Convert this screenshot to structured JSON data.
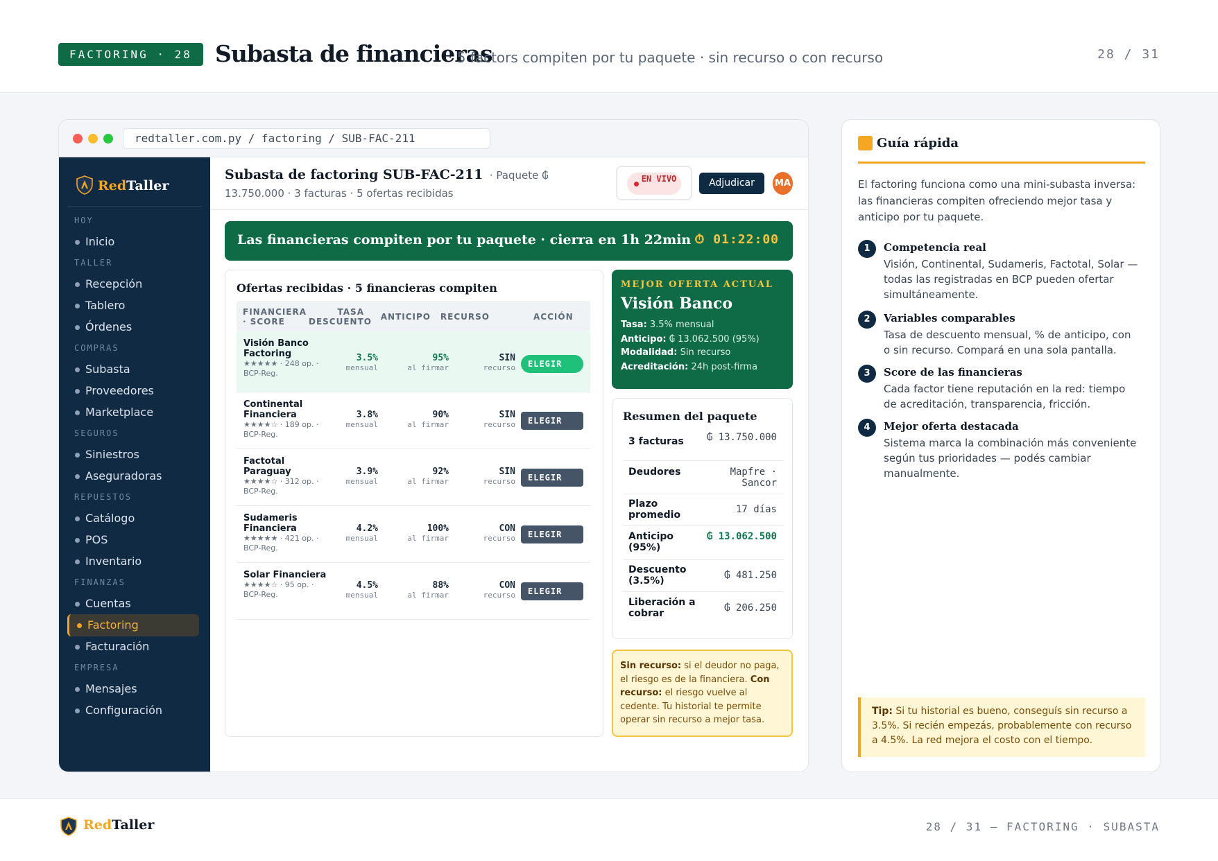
{
  "header": {
    "badge": "FACTORING · 28",
    "title": "Subasta de financieras",
    "subtitle": "· 5 factors compiten por tu paquete · sin recurso o con recurso",
    "page": "28 / 31"
  },
  "browser": {
    "url": "redtaller.com.py / factoring / SUB-FAC-211"
  },
  "brand": {
    "red": "Red",
    "taller": "Taller"
  },
  "sidebar": {
    "sections": [
      {
        "label": "HOY",
        "items": [
          "Inicio"
        ]
      },
      {
        "label": "TALLER",
        "items": [
          "Recepción",
          "Tablero",
          "Órdenes"
        ]
      },
      {
        "label": "COMPRAS",
        "items": [
          "Subasta",
          "Proveedores",
          "Marketplace"
        ]
      },
      {
        "label": "SEGUROS",
        "items": [
          "Siniestros",
          "Aseguradoras"
        ]
      },
      {
        "label": "REPUESTOS",
        "items": [
          "Catálogo",
          "POS",
          "Inventario"
        ]
      },
      {
        "label": "FINANZAS",
        "items": [
          "Cuentas",
          "Factoring",
          "Facturación"
        ]
      },
      {
        "label": "EMPRESA",
        "items": [
          "Mensajes",
          "Configuración"
        ]
      }
    ],
    "active": "Factoring"
  },
  "main": {
    "title": "Subasta de factoring SUB-FAC-211",
    "meta": "· Paquete ₲ 13.750.000 · 3 facturas · 5 ofertas recibidas",
    "live": "EN VIVO",
    "adjudicar": "Adjudicar",
    "avatar": "MA",
    "banner": "Las financieras compiten por tu paquete · cierra en 1h 22min",
    "timer": "⏱ 01:22:00"
  },
  "offers": {
    "title": "Ofertas recibidas · 5 financieras compiten",
    "columns": {
      "fin": "FINANCIERA · SCORE",
      "tasa": "TASA DESCUENTO",
      "anticipo": "ANTICIPO",
      "recurso": "RECURSO",
      "accion": "ACCIÓN"
    },
    "rows": [
      {
        "name": "Visión Banco Factoring",
        "score": "★★★★★ · 248 op. · BCP-Reg.",
        "tasa": "3.5%",
        "tasa_sub": "mensual",
        "anticipo": "95%",
        "anticipo_sub": "al firmar",
        "recurso": "SIN",
        "recurso_sub": "recurso",
        "action": "ELEGIR"
      },
      {
        "name": "Continental Financiera",
        "score": "★★★★☆ · 189 op. · BCP-Reg.",
        "tasa": "3.8%",
        "tasa_sub": "mensual",
        "anticipo": "90%",
        "anticipo_sub": "al firmar",
        "recurso": "SIN",
        "recurso_sub": "recurso",
        "action": "ELEGIR"
      },
      {
        "name": "Factotal Paraguay",
        "score": "★★★★☆ · 312 op. · BCP-Reg.",
        "tasa": "3.9%",
        "tasa_sub": "mensual",
        "anticipo": "92%",
        "anticipo_sub": "al firmar",
        "recurso": "SIN",
        "recurso_sub": "recurso",
        "action": "ELEGIR"
      },
      {
        "name": "Sudameris Financiera",
        "score": "★★★★★ · 421 op. · BCP-Reg.",
        "tasa": "4.2%",
        "tasa_sub": "mensual",
        "anticipo": "100%",
        "anticipo_sub": "al firmar",
        "recurso": "CON",
        "recurso_sub": "recurso",
        "action": "ELEGIR"
      },
      {
        "name": "Solar Financiera",
        "score": "★★★★☆ · 95 op. · BCP-Reg.",
        "tasa": "4.5%",
        "tasa_sub": "mensual",
        "anticipo": "88%",
        "anticipo_sub": "al firmar",
        "recurso": "CON",
        "recurso_sub": "recurso",
        "action": "ELEGIR"
      }
    ]
  },
  "best": {
    "label": "MEJOR OFERTA ACTUAL",
    "name": "Visión Banco",
    "lines": [
      {
        "k": "Tasa:",
        "v": "3.5% mensual"
      },
      {
        "k": "Anticipo:",
        "v": "₲ 13.062.500 (95%)"
      },
      {
        "k": "Modalidad:",
        "v": "Sin recurso"
      },
      {
        "k": "Acreditación:",
        "v": "24h post-firma"
      }
    ]
  },
  "summary": {
    "title": "Resumen del paquete",
    "rows": [
      {
        "k": "3 facturas",
        "v": "₲ 13.750.000"
      },
      {
        "k": "Deudores",
        "v": "Mapfre · Sancor"
      },
      {
        "k": "Plazo promedio",
        "v": "17 días"
      },
      {
        "k": "Anticipo (95%)",
        "v": "₲ 13.062.500"
      },
      {
        "k": "Descuento (3.5%)",
        "v": "₲ 481.250"
      },
      {
        "k": "Liberación a cobrar",
        "v": "₲ 206.250"
      }
    ]
  },
  "note": {
    "sin_k": "Sin recurso:",
    "sin_v": "si el deudor no paga, el riesgo es de la financiera.",
    "con_k": "Con recurso:",
    "con_v": "el riesgo vuelve al cedente. Tu historial te permite operar sin recurso a mejor tasa."
  },
  "guide": {
    "title": "Guía rápida",
    "intro": "El factoring funciona como una mini-subasta inversa: las financieras compiten ofreciendo mejor tasa y anticipo por tu paquete.",
    "items": [
      {
        "n": "1",
        "h": "Competencia real",
        "d": "Visión, Continental, Sudameris, Factotal, Solar — todas las registradas en BCP pueden ofertar simultáneamente."
      },
      {
        "n": "2",
        "h": "Variables comparables",
        "d": "Tasa de descuento mensual, % de anticipo, con o sin recurso. Compará en una sola pantalla."
      },
      {
        "n": "3",
        "h": "Score de las financieras",
        "d": "Cada factor tiene reputación en la red: tiempo de acreditación, transparencia, fricción."
      },
      {
        "n": "4",
        "h": "Mejor oferta destacada",
        "d": "Sistema marca la combinación más conveniente según tus prioridades — podés cambiar manualmente."
      }
    ],
    "tip_k": "Tip:",
    "tip_v": "Si tu historial es bueno, conseguís sin recurso a 3.5%. Si recién empezás, probablemente con recurso a 4.5%. La red mejora el costo con el tiempo."
  },
  "footer": {
    "right": "28 / 31 — FACTORING · SUBASTA"
  }
}
